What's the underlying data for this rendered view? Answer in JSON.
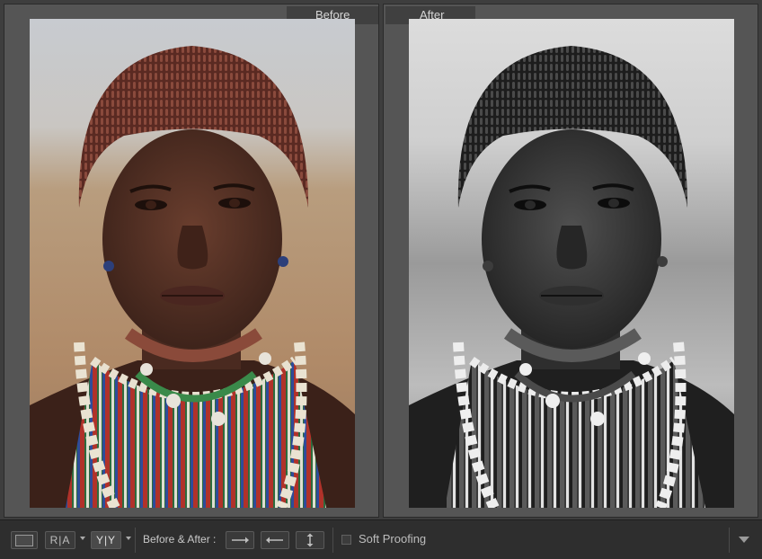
{
  "panes": {
    "before_label": "Before",
    "after_label": "After"
  },
  "toolbar": {
    "view_loupe_icon": "single-view-icon",
    "view_ra_label": "R|A",
    "view_yy_label": "Y|Y",
    "before_after_label": "Before & After :",
    "copy_before_to_after_icon": "arrow-right-icon",
    "copy_after_to_before_icon": "arrow-left-icon",
    "swap_icon": "swap-vertical-icon",
    "soft_proofing_label": "Soft Proofing",
    "soft_proofing_checked": false,
    "menu_icon": "triangle-down-icon"
  },
  "colors": {
    "panel_bg": "#555555",
    "toolbar_bg": "#2e2e2e",
    "label_text": "#d6d6d6"
  }
}
